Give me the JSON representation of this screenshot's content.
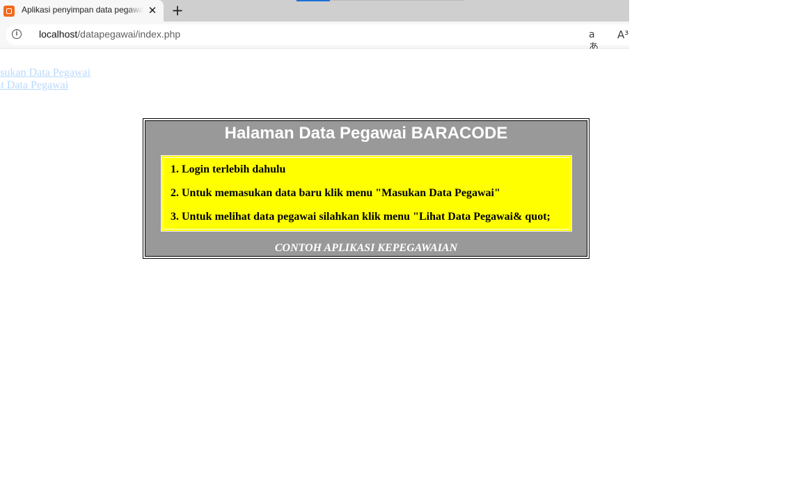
{
  "browser": {
    "tab_title": "Aplikasi penyimpan data pegawai",
    "close_glyph": "✕",
    "new_tab_glyph": "+",
    "info_glyph": "i",
    "url_host": "localhost",
    "url_path": "/datapegawai/index.php",
    "translate_glyph": "aあ",
    "read_aloud_glyph": "A³"
  },
  "menu": {
    "links": [
      "Masukan Data Pegawai",
      "Lihat Data Pegawai"
    ]
  },
  "main": {
    "title": "Halaman Data Pegawai BARACODE",
    "steps": [
      "1. Login terlebih dahulu",
      "2. Untuk memasukan data baru klik menu \"Masukan Data Pegawai\"",
      "3. Untuk melihat data pegawai silahkan klik menu \"Lihat Data Pegawai& quot;"
    ],
    "footer": "CONTOH APLIKASI KEPEGAWAIAN"
  },
  "colors": {
    "panel_bg": "#999999",
    "instructions_bg": "#ffff00",
    "link": "#b8d9ff",
    "tab_accent": "#1d6fd6"
  }
}
